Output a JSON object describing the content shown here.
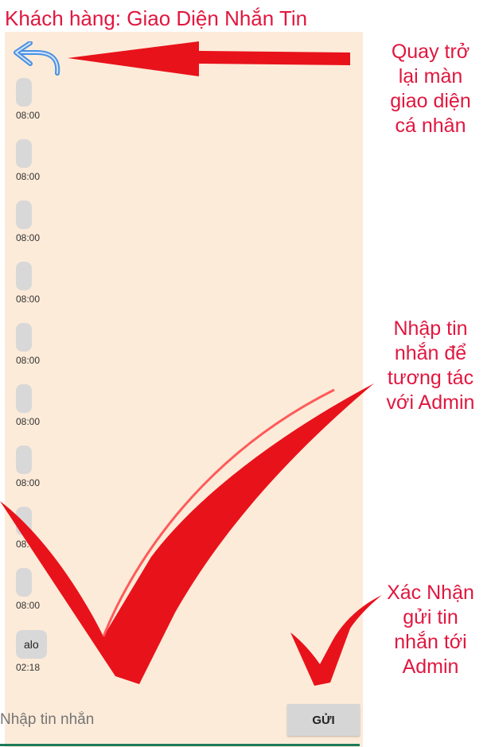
{
  "title": "Khách hàng: Giao Diện Nhắn Tin",
  "back_icon": "back-arrow-icon",
  "messages": [
    {
      "time": "08:00"
    },
    {
      "time": "08:00"
    },
    {
      "time": "08:00"
    },
    {
      "time": "08:00"
    },
    {
      "time": "08:00"
    },
    {
      "time": "08:00"
    },
    {
      "time": "08:00"
    },
    {
      "time": "08:00"
    },
    {
      "time": "08:00"
    },
    {
      "text": "alo",
      "time": "02:18"
    }
  ],
  "input": {
    "placeholder": "Nhập tin nhắn"
  },
  "send_label": "GỬI",
  "annotations": {
    "back": [
      "Quay trở",
      "lại màn",
      "giao diện",
      "cá nhân"
    ],
    "input": [
      "Nhập tin",
      "nhắn để",
      "tương tác",
      "với Admin"
    ],
    "send": [
      "Xác Nhận",
      "gửi tin",
      "nhắn tới",
      "Admin"
    ]
  },
  "colors": {
    "annotation": "#e0173f",
    "arrow": "#e8121b",
    "screen_bg": "#fdebd9"
  }
}
